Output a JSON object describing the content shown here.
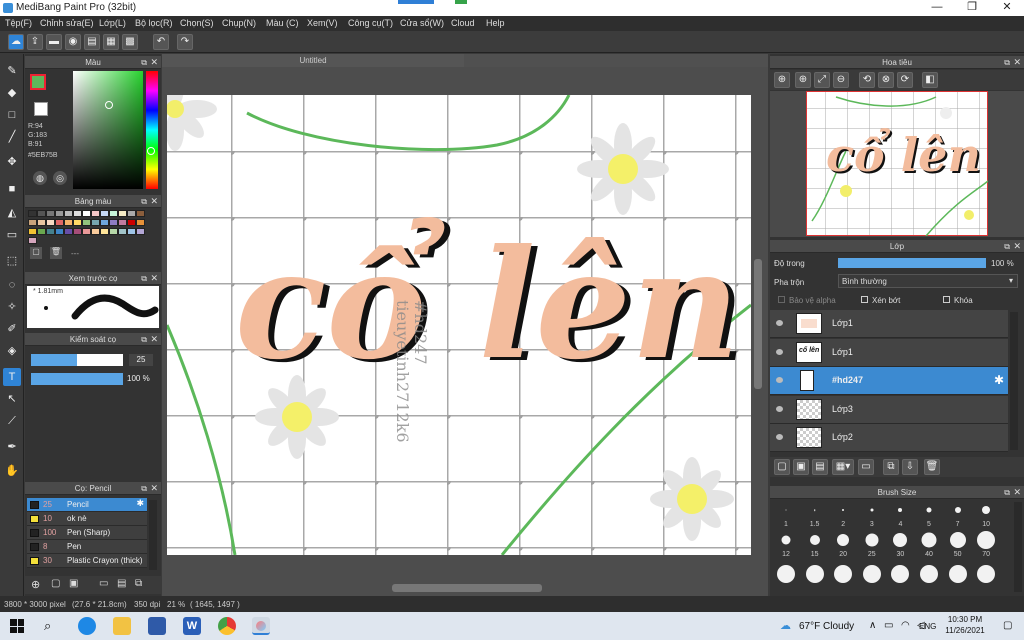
{
  "window": {
    "title": "MediBang Paint Pro (32bit)",
    "minimize": "—",
    "maximize": "❐",
    "close": "✕"
  },
  "menu": [
    "Tệp(F)",
    "Chỉnh sửa(E)",
    "Lớp(L)",
    "Bộ lọc(R)",
    "Chọn(S)",
    "Chụp(N)",
    "Màu (C)",
    "Xem(V)",
    "Công cụ(T)",
    "Cửa sổ(W)",
    "Cloud",
    "Help"
  ],
  "color_panel": {
    "title": "Màu",
    "r": "R:94",
    "g": "G:183",
    "b": "B:91",
    "hex": "#5EB75B",
    "fg": "#5EB75B",
    "bg": "#ffffff"
  },
  "palette_panel": {
    "title": "Bảng màu",
    "more": "---"
  },
  "preview_panel": {
    "title": "Xem trước cọ",
    "size": "1.81mm"
  },
  "control_panel": {
    "title": "Kiểm soát cọ",
    "size_value": "25",
    "opacity_value": "100 %"
  },
  "brush_panel": {
    "title": "Cọ: Pencil",
    "items": [
      {
        "size": "25",
        "name": "Pencil",
        "color": "#222222",
        "selected": true
      },
      {
        "size": "10",
        "name": "ok nè",
        "color": "#f4e03a",
        "selected": false
      },
      {
        "size": "100",
        "name": "Pen (Sharp)",
        "color": "#222222",
        "selected": false
      },
      {
        "size": "8",
        "name": "Pen",
        "color": "#222222",
        "selected": false
      },
      {
        "size": "30",
        "name": "Plastic Crayon (thick)",
        "color": "#f4e03a",
        "selected": false
      }
    ]
  },
  "canvas": {
    "tab": "Untitled",
    "headline": "cổ lên",
    "watermark_1": "#hd247",
    "watermark_2": "tieuyetinh2712k6"
  },
  "navigator": {
    "title": "Hoa tiêu",
    "headline": "cổ lên"
  },
  "layer_panel": {
    "title": "Lớp",
    "opacity_label": "Độ trong",
    "opacity_value": "100 %",
    "opacity_fraction": 1.0,
    "blend_label": "Pha trộn",
    "blend_value": "Bình thường",
    "protect_alpha": "Bảo vệ alpha",
    "clipping": "Xén bớt",
    "lock": "Khóa",
    "layers": [
      {
        "name": "Lớp1",
        "selected": false,
        "thumb": ""
      },
      {
        "name": "Lớp1",
        "selected": false,
        "thumb": "cổ lên"
      },
      {
        "name": "#hd247",
        "selected": true,
        "thumb": ""
      },
      {
        "name": "Lớp3",
        "selected": false,
        "thumb": ""
      },
      {
        "name": "Lớp2",
        "selected": false,
        "thumb": ""
      }
    ]
  },
  "brush_size_panel": {
    "title": "Brush Size",
    "sizes": [
      "1",
      "1.5",
      "2",
      "3",
      "4",
      "5",
      "7",
      "10",
      "12",
      "15",
      "20",
      "25",
      "30",
      "40",
      "50",
      "70"
    ]
  },
  "status": {
    "dims": "3800 * 3000 pixel",
    "cm": "(27.6 * 21.8cm)",
    "dpi": "350 dpi",
    "zoom": "21 %",
    "coords": "( 1645, 1497 )"
  },
  "taskbar": {
    "weather": "67°F  Cloudy",
    "lang": "ENG",
    "time": "10:30 PM",
    "date": "11/26/2021"
  }
}
